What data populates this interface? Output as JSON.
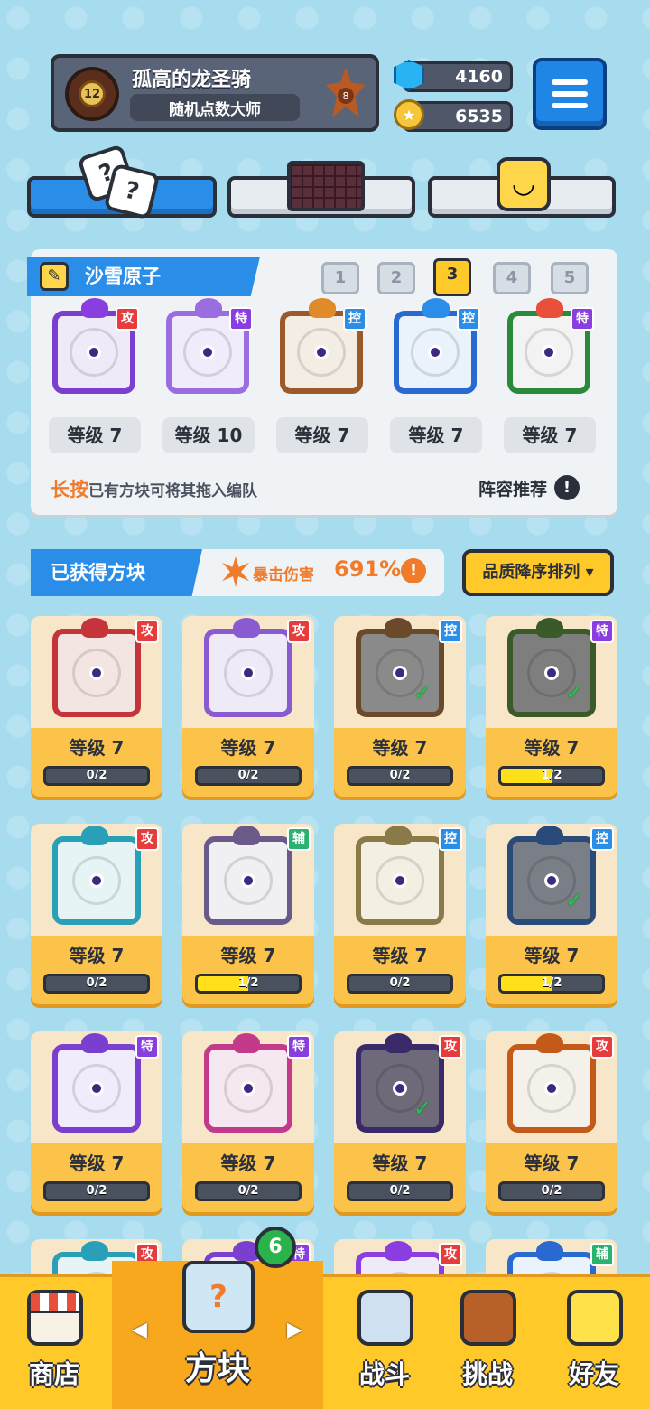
{
  "profile": {
    "player_name": "孤高的龙圣骑",
    "player_title": "随机点数大师",
    "avatar_level": "12",
    "rank_badge": "8"
  },
  "currency": {
    "gems": "4160",
    "coins": "6535"
  },
  "deck": {
    "name": "沙雪原子",
    "deck_numbers": [
      "1",
      "2",
      "3",
      "4",
      "5"
    ],
    "active_deck": "3",
    "slots": [
      {
        "tag": "攻",
        "tag_type": "atk",
        "level": "等级 7",
        "frame_color": "#7b3fd0",
        "dragon_color": "#8a3ee0",
        "inner": "#efeaf7"
      },
      {
        "tag": "特",
        "tag_type": "spc",
        "level": "等级 10",
        "frame_color": "#9a6ee0",
        "dragon_color": "#9a6ee0",
        "inner": "#f1ecfb"
      },
      {
        "tag": "控",
        "tag_type": "ctl",
        "level": "等级 7",
        "frame_color": "#9a5a2a",
        "dragon_color": "#e08a2a",
        "inner": "#f4ede4"
      },
      {
        "tag": "控",
        "tag_type": "ctl",
        "level": "等级 7",
        "frame_color": "#2a6ad0",
        "dragon_color": "#2a8ee8",
        "inner": "#eaf3fb"
      },
      {
        "tag": "特",
        "tag_type": "spc",
        "level": "等级 7",
        "frame_color": "#2a8a3a",
        "dragon_color": "#e8503b",
        "inner": "#f3f3f3"
      }
    ],
    "hint_emphasis": "长按",
    "hint_text": "已有方块可将其拖入编队",
    "recommend_label": "阵容推荐",
    "recommend_icon": "exclamation-icon"
  },
  "owned": {
    "title": "已获得方块",
    "crit_label": "暴击伤害",
    "crit_value": "691%",
    "sort_label": "品质降序排列 ▾",
    "cards": [
      {
        "tag": "攻",
        "tag_type": "atk",
        "level": "等级 7",
        "progress": "0/2",
        "fill": 0,
        "frame": "#c4343a",
        "inner": "#f3e6e2",
        "checked": false
      },
      {
        "tag": "攻",
        "tag_type": "atk",
        "level": "等级 7",
        "progress": "0/2",
        "fill": 0,
        "frame": "#8a5ad0",
        "inner": "#efeaf7",
        "checked": false
      },
      {
        "tag": "控",
        "tag_type": "ctl",
        "level": "等级 7",
        "progress": "0/2",
        "fill": 0,
        "frame": "#6a4a2a",
        "inner": "#8a8a8a",
        "checked": true
      },
      {
        "tag": "特",
        "tag_type": "spc",
        "level": "等级 7",
        "progress": "1/2",
        "fill": 0.5,
        "frame": "#3a5a2a",
        "inner": "#7e7e7e",
        "checked": true
      },
      {
        "tag": "攻",
        "tag_type": "atk",
        "level": "等级 7",
        "progress": "0/2",
        "fill": 0,
        "frame": "#2aa0b8",
        "inner": "#e6f4f6",
        "checked": false
      },
      {
        "tag": "辅",
        "tag_type": "sup",
        "level": "等级 7",
        "progress": "1/2",
        "fill": 0.5,
        "frame": "#6a5a8a",
        "inner": "#f0f0f2",
        "checked": false
      },
      {
        "tag": "控",
        "tag_type": "ctl",
        "level": "等级 7",
        "progress": "0/2",
        "fill": 0,
        "frame": "#8a7a4a",
        "inner": "#f3efe2",
        "checked": false
      },
      {
        "tag": "控",
        "tag_type": "ctl",
        "level": "等级 7",
        "progress": "1/2",
        "fill": 0.5,
        "frame": "#2a4a7a",
        "inner": "#7a7e86",
        "checked": true
      },
      {
        "tag": "特",
        "tag_type": "spc",
        "level": "等级 7",
        "progress": "0/2",
        "fill": 0,
        "frame": "#7b3fd0",
        "inner": "#f1ecfb",
        "checked": false
      },
      {
        "tag": "特",
        "tag_type": "spc",
        "level": "等级 7",
        "progress": "0/2",
        "fill": 0,
        "frame": "#c43a8a",
        "inner": "#f6e8f0",
        "checked": false
      },
      {
        "tag": "攻",
        "tag_type": "atk",
        "level": "等级 7",
        "progress": "0/2",
        "fill": 0,
        "frame": "#3a2a6a",
        "inner": "#6e6a7a",
        "checked": true
      },
      {
        "tag": "攻",
        "tag_type": "atk",
        "level": "等级 7",
        "progress": "0/2",
        "fill": 0,
        "frame": "#c45a1a",
        "inner": "#f4f0ea",
        "checked": false
      },
      {
        "tag": "攻",
        "tag_type": "atk",
        "level": "",
        "progress": "",
        "fill": 0,
        "frame": "#2aa0b8",
        "inner": "#e6f4f6",
        "checked": false
      },
      {
        "tag": "特",
        "tag_type": "spc",
        "level": "",
        "progress": "",
        "fill": 0,
        "frame": "#7b3fd0",
        "inner": "#efeaf7",
        "checked": false
      },
      {
        "tag": "攻",
        "tag_type": "atk",
        "level": "",
        "progress": "",
        "fill": 0,
        "frame": "#8a3ee0",
        "inner": "#efeaf7",
        "checked": false
      },
      {
        "tag": "辅",
        "tag_type": "sup",
        "level": "",
        "progress": "",
        "fill": 0,
        "frame": "#2a6ad0",
        "inner": "#eaf3fb",
        "checked": false
      }
    ]
  },
  "nav": {
    "shop": "商店",
    "blocks": "方块",
    "battle": "战斗",
    "challenge": "挑战",
    "friends": "好友",
    "blocks_badge": "6",
    "prev_arrow": "◀",
    "next_arrow": "▶"
  }
}
